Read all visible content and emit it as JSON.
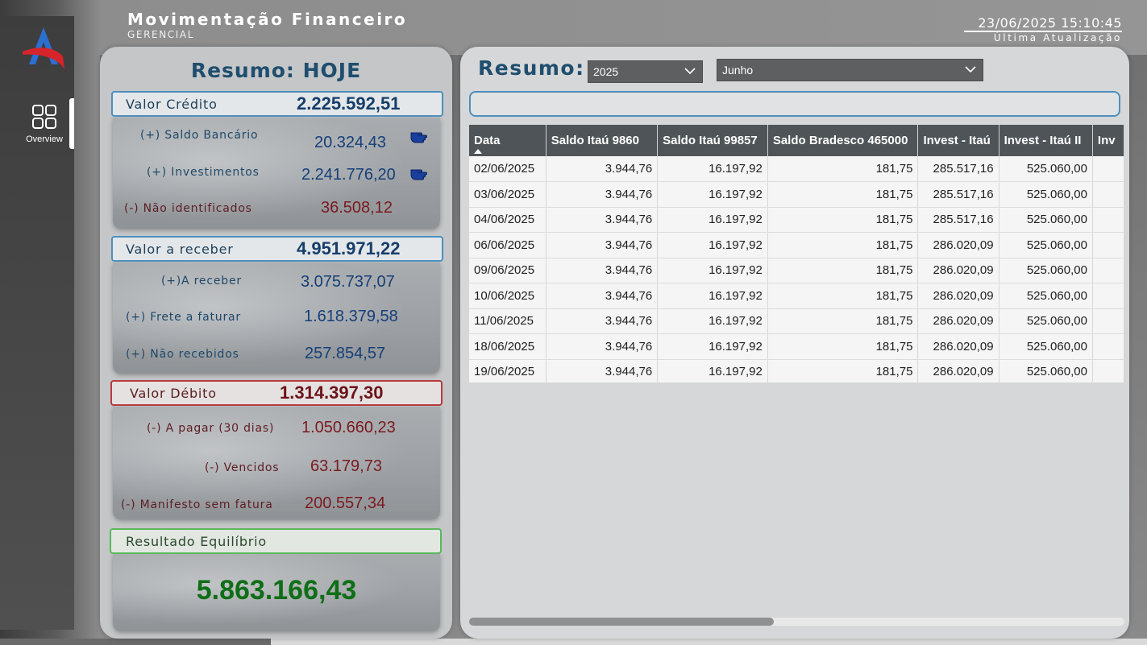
{
  "header": {
    "title": "Movimentação Financeiro",
    "subtitle": "GERENCIAL",
    "datetime": "23/06/2025 15:10:45",
    "last_update_label": "Última Atualização"
  },
  "nav": {
    "items": [
      {
        "label": "Overview",
        "icon": "dashboard-grid-icon"
      }
    ]
  },
  "left": {
    "title": "Resumo: HOJE",
    "credito": {
      "label": "Valor Crédito",
      "value": "2.225.592,51",
      "rows": [
        {
          "label": "(+) Saldo Bancário",
          "value": "20.324,43"
        },
        {
          "label": "(+) Investimentos",
          "value": "2.241.776,20"
        },
        {
          "label": "(-) Não identificados",
          "value": "36.508,12"
        }
      ]
    },
    "receber": {
      "label": "Valor a receber",
      "value": "4.951.971,22",
      "rows": [
        {
          "label": "(+)A receber",
          "value": "3.075.737,07"
        },
        {
          "label": "(+) Frete a faturar",
          "value": "1.618.379,58"
        },
        {
          "label": "(+) Não recebidos",
          "value": "257.854,57"
        }
      ]
    },
    "debito": {
      "label": "Valor Débito",
      "value": "1.314.397,30",
      "rows": [
        {
          "label": "(-) A pagar (30 dias)",
          "value": "1.050.660,23"
        },
        {
          "label": "(-) Vencidos",
          "value": "63.179,73"
        },
        {
          "label": "(-) Manifesto sem fatura",
          "value": "200.557,34"
        }
      ]
    },
    "resultado": {
      "label": "Resultado Equilíbrio",
      "value": "5.863.166,43"
    }
  },
  "right": {
    "title": "Resumo:",
    "year_select": "2025",
    "month_select": "Junho",
    "table": {
      "columns": [
        "Data",
        "Saldo Itaú 9860",
        "Saldo Itaú 99857",
        "Saldo Bradesco 465000",
        "Invest - Itaú",
        "Invest - Itaú II",
        "Inv"
      ],
      "rows": [
        [
          "02/06/2025",
          "3.944,76",
          "16.197,92",
          "181,75",
          "285.517,16",
          "525.060,00",
          ""
        ],
        [
          "03/06/2025",
          "3.944,76",
          "16.197,92",
          "181,75",
          "285.517,16",
          "525.060,00",
          ""
        ],
        [
          "04/06/2025",
          "3.944,76",
          "16.197,92",
          "181,75",
          "285.517,16",
          "525.060,00",
          ""
        ],
        [
          "06/06/2025",
          "3.944,76",
          "16.197,92",
          "181,75",
          "286.020,09",
          "525.060,00",
          ""
        ],
        [
          "09/06/2025",
          "3.944,76",
          "16.197,92",
          "181,75",
          "286.020,09",
          "525.060,00",
          ""
        ],
        [
          "10/06/2025",
          "3.944,76",
          "16.197,92",
          "181,75",
          "286.020,09",
          "525.060,00",
          ""
        ],
        [
          "11/06/2025",
          "3.944,76",
          "16.197,92",
          "181,75",
          "286.020,09",
          "525.060,00",
          ""
        ],
        [
          "18/06/2025",
          "3.944,76",
          "16.197,92",
          "181,75",
          "286.020,09",
          "525.060,00",
          ""
        ],
        [
          "19/06/2025",
          "3.944,76",
          "16.197,92",
          "181,75",
          "286.020,09",
          "525.060,00",
          ""
        ]
      ]
    }
  },
  "colors": {
    "accent_blue": "#4d8fbc",
    "accent_red": "#b73a3f",
    "accent_green": "#58b85a",
    "result_green": "#0f6e16"
  }
}
